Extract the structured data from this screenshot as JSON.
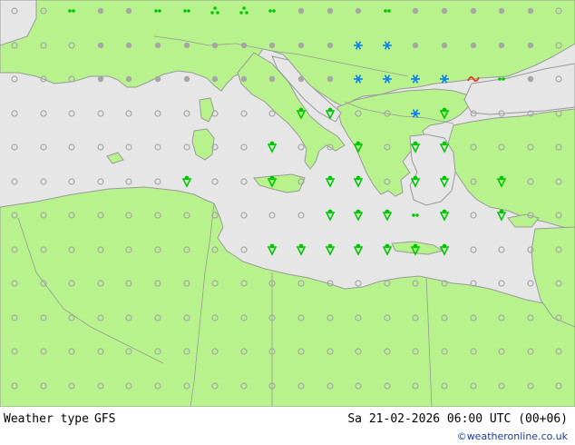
{
  "title": "Weather type",
  "model": "GFS",
  "datetime": "Sa 21-02-2026 06:00 UTC (00+06)",
  "credit": "©weatheronline.co.uk",
  "colors": {
    "sea": "#e6e6e6",
    "land": "#b8f28c",
    "coast": "#9a9a9a",
    "border": "#999999",
    "clear_symbol": "#a6a6a6",
    "rain_symbol": "#00c800",
    "snow_symbol": "#0a7ef0",
    "freezing_symbol": "#e03c1e"
  },
  "legend_symbols": [
    "clear-icon",
    "cloudy-icon",
    "shower-icon",
    "rain-icon",
    "drizzle-icon",
    "snow-icon",
    "freezing-rain-icon"
  ]
}
